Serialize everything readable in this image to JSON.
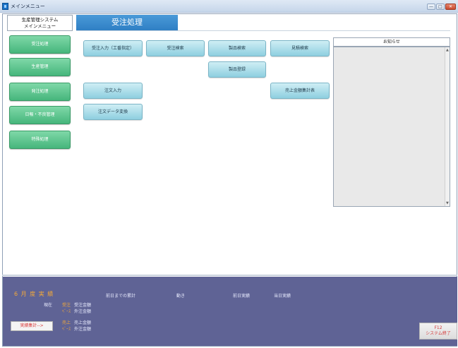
{
  "window": {
    "title": "メインメニュー",
    "min_label": "—",
    "max_label": "□",
    "close_label": "✕"
  },
  "menu_header": {
    "line1": "生産管理システム",
    "line2": "メインメニュー"
  },
  "sidebar": {
    "items": [
      {
        "label": "受注処理"
      },
      {
        "label": "生産管理"
      },
      {
        "label": "発注処理"
      },
      {
        "label": "日報・不良管理"
      },
      {
        "label": "特殊処理"
      }
    ]
  },
  "heading": {
    "title": "受注処理"
  },
  "actions": {
    "order_input_kouban": "受注入力（工番指定）",
    "order_search": "受注検索",
    "product_search": "製品検索",
    "estimate_search": "見積検索",
    "product_register": "製品登録",
    "order_entry": "注文入力",
    "sales_summary": "売上金額集計表",
    "order_data_convert": "注文データ変換"
  },
  "news": {
    "title": "お知らせ",
    "scroll_up": "▲",
    "scroll_down": "▼"
  },
  "bottom": {
    "month_title": "6 月 度 実 績",
    "current_label": "現在",
    "col_prev_total": "前日までの累計",
    "col_movement": "動き",
    "col_prev_day": "前日実績",
    "col_today": "当日実績",
    "rows": [
      {
        "kind": "受注",
        "label": "受注金額"
      },
      {
        "kind": "ﾍﾞｰｽ",
        "label": "外注金額"
      },
      {
        "kind": "売上",
        "label": "売上金額"
      },
      {
        "kind": "ﾍﾞｰｽ",
        "label": "外注金額"
      }
    ],
    "summary_button": "実績集計-->",
    "exit_key": "F12",
    "exit_label": "システム終了"
  }
}
